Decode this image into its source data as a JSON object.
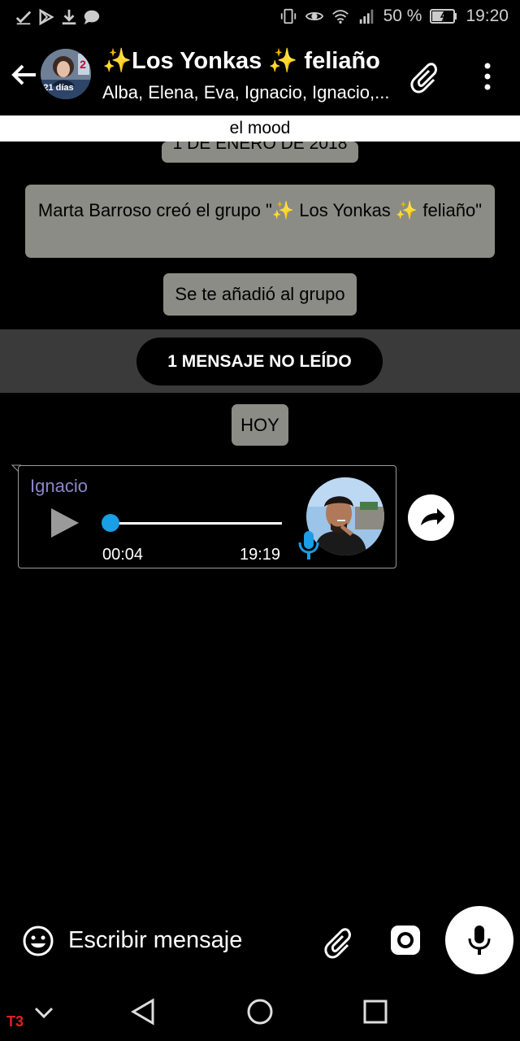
{
  "status_bar": {
    "battery": "50 %",
    "time": "19:20"
  },
  "header": {
    "title": "✨Los Yonkas ✨ feliaño",
    "members": "Alba, Elena, Eva, Ignacio, Ignacio,...",
    "avatar_text": "21 días"
  },
  "pinned": {
    "text": "el mood"
  },
  "chat": {
    "date_chip": "1 DE ENERO DE 2018",
    "created_notice": "Marta Barroso creó el grupo \"✨ Los Yonkas ✨ feliaño\"",
    "added_notice": "Se te añadió al grupo",
    "unread": "1 MENSAJE NO LEÍDO",
    "today": "HOY",
    "voice_message": {
      "sender": "Ignacio",
      "duration": "00:04",
      "time": "19:19",
      "progress": 0
    }
  },
  "composer": {
    "placeholder": "Escribir mensaje"
  },
  "colors": {
    "chip": "#8b8c85",
    "sender_name": "#8c86c9",
    "progress_knob": "#1a9ee6"
  },
  "watermark": "T3"
}
